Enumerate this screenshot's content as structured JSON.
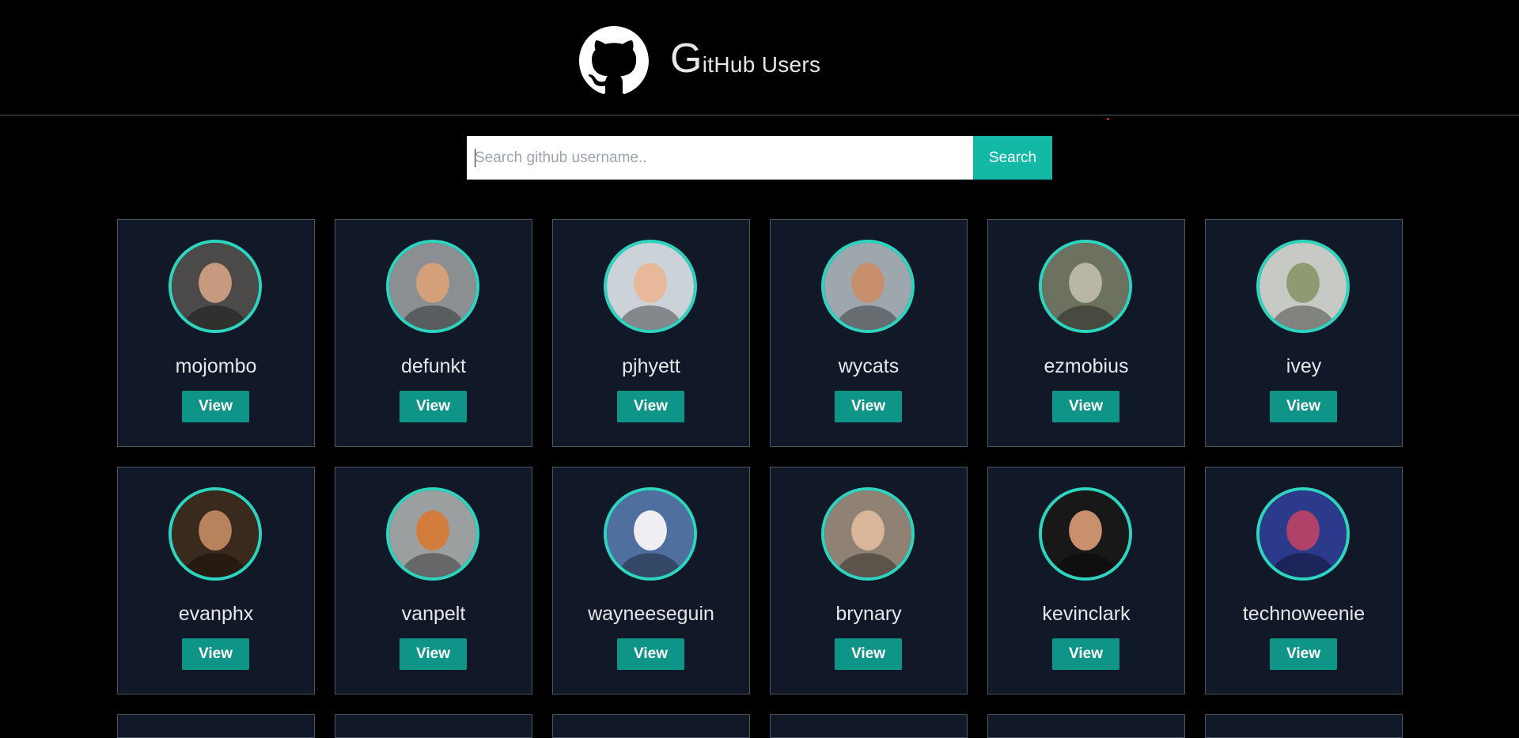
{
  "header": {
    "title_initial": "G",
    "title_rest": "itHub Users"
  },
  "search": {
    "placeholder": "Search github username..",
    "value": "",
    "button_label": "Search"
  },
  "users": [
    {
      "username": "mojombo",
      "view_label": "View",
      "avatar_bg": "#4b4a48",
      "avatar_fg": "#c79a80"
    },
    {
      "username": "defunkt",
      "view_label": "View",
      "avatar_bg": "#8b8f92",
      "avatar_fg": "#d4a07a"
    },
    {
      "username": "pjhyett",
      "view_label": "View",
      "avatar_bg": "#cbd2d8",
      "avatar_fg": "#e7b99a"
    },
    {
      "username": "wycats",
      "view_label": "View",
      "avatar_bg": "#9ea6ae",
      "avatar_fg": "#c78f6e"
    },
    {
      "username": "ezmobius",
      "view_label": "View",
      "avatar_bg": "#6d7260",
      "avatar_fg": "#b9b7a3"
    },
    {
      "username": "ivey",
      "view_label": "View",
      "avatar_bg": "#c7c9c4",
      "avatar_fg": "#8e9a71"
    },
    {
      "username": "evanphx",
      "view_label": "View",
      "avatar_bg": "#3a2a1e",
      "avatar_fg": "#b7825c"
    },
    {
      "username": "vanpelt",
      "view_label": "View",
      "avatar_bg": "#9c9fa0",
      "avatar_fg": "#d27d3c"
    },
    {
      "username": "wayneeseguin",
      "view_label": "View",
      "avatar_bg": "#4f6f9e",
      "avatar_fg": "#f0eef2"
    },
    {
      "username": "brynary",
      "view_label": "View",
      "avatar_bg": "#8f8275",
      "avatar_fg": "#d9b59a"
    },
    {
      "username": "kevinclark",
      "view_label": "View",
      "avatar_bg": "#181818",
      "avatar_fg": "#c9906d"
    },
    {
      "username": "technoweenie",
      "view_label": "View",
      "avatar_bg": "#2b3a8a",
      "avatar_fg": "#b0426a"
    }
  ],
  "colors": {
    "accent": "#14b8a6",
    "view_button": "#0f9488",
    "avatar_ring": "#2dd4bf",
    "card_bg": "#111827"
  }
}
